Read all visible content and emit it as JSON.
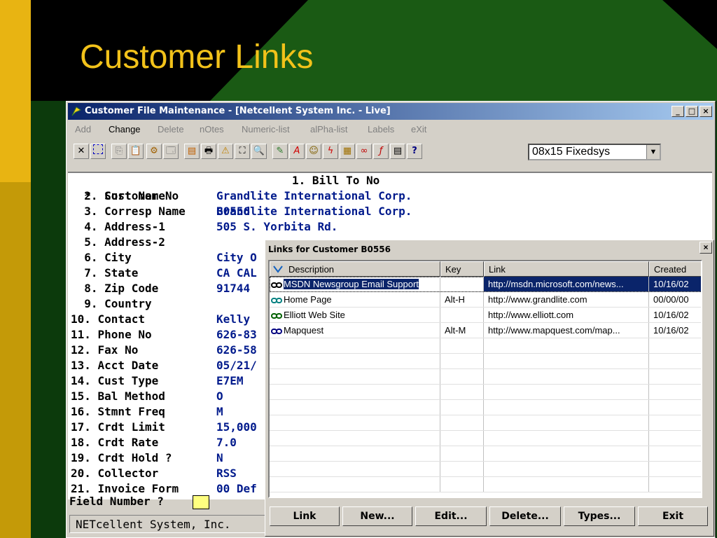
{
  "slide": {
    "title": "Customer Links"
  },
  "window": {
    "title": "Customer File Maintenance - [Netcellent System Inc. - Live]",
    "controls": {
      "minimize": "_",
      "maximize": "□",
      "close": "×"
    }
  },
  "menu": [
    {
      "label": "Add",
      "enabled": false
    },
    {
      "label": "Change",
      "enabled": true
    },
    {
      "label": "Delete",
      "enabled": false
    },
    {
      "label": "nOtes",
      "enabled": false
    },
    {
      "label": "Numeric-list",
      "enabled": false
    },
    {
      "label": "alPha-list",
      "enabled": false
    },
    {
      "label": "Labels",
      "enabled": false
    },
    {
      "label": "eXit",
      "enabled": false
    }
  ],
  "toolbar": {
    "icons": [
      "close-icon",
      "select-icon",
      "copy-icon",
      "paste-icon",
      "settings-icon",
      "properties-icon",
      "notes-icon",
      "print-icon",
      "alert-icon",
      "find-icon",
      "zoom-icon",
      "logo-icon",
      "font-icon",
      "user-icon",
      "lightning-icon",
      "calc-icon",
      "link-icon",
      "function-icon",
      "list-icon",
      "help-icon"
    ],
    "font_select": {
      "value": "08x15 Fixedsys"
    }
  },
  "fields": [
    {
      "label": "  *  Customer No",
      "value": "B0556"
    },
    {
      "label": "  2. Sort Name",
      "value": "Grandlite International Corp."
    },
    {
      "label": "  3. Corresp Name",
      "value": "Grandlite International Corp."
    },
    {
      "label": "  4. Address-1",
      "value": "505 S. Yorbita Rd."
    },
    {
      "label": "  5. Address-2",
      "value": ""
    },
    {
      "label": "  6. City",
      "value": "City O"
    },
    {
      "label": "  7. State",
      "value": "CA CAL"
    },
    {
      "label": "  8. Zip Code",
      "value": "91744"
    },
    {
      "label": "  9. Country",
      "value": ""
    },
    {
      "label": "10. Contact",
      "value": "Kelly"
    },
    {
      "label": "11. Phone No",
      "value": "626-83"
    },
    {
      "label": "12. Fax No",
      "value": "626-58"
    },
    {
      "label": "13. Acct Date",
      "value": "05/21/"
    },
    {
      "label": "14. Cust Type",
      "value": "E7EM"
    },
    {
      "label": "15. Bal Method",
      "value": "O"
    },
    {
      "label": "16. Stmnt Freq",
      "value": "M"
    },
    {
      "label": "17. Crdt Limit",
      "value": "15,000"
    },
    {
      "label": "18. Crdt Rate",
      "value": "7.0"
    },
    {
      "label": "19. Crdt Hold ?",
      "value": "N"
    },
    {
      "label": "20. Collector",
      "value": "RSS"
    },
    {
      "label": "21. Invoice Form",
      "value": "00 Def"
    }
  ],
  "bill_to": "1. Bill To No",
  "prompt": {
    "label": "Field Number ?"
  },
  "status": {
    "text": "NETcellent System, Inc."
  },
  "dialog": {
    "title": "Links for Customer B0556",
    "close": "×",
    "columns": [
      "Description",
      "Key",
      "Link",
      "Created"
    ],
    "rows": [
      {
        "description": "MSDN Newsgroup Email Support",
        "key": "",
        "link": "http://msdn.microsoft.com/news...",
        "created": "10/16/02",
        "selected": true
      },
      {
        "description": "Home Page",
        "key": "Alt-H",
        "link": "http://www.grandlite.com",
        "created": "00/00/00",
        "selected": false
      },
      {
        "description": "Elliott Web Site",
        "key": "",
        "link": "http://www.elliott.com",
        "created": "10/16/02",
        "selected": false
      },
      {
        "description": "Mapquest",
        "key": "Alt-M",
        "link": "http://www.mapquest.com/map...",
        "created": "10/16/02",
        "selected": false
      }
    ],
    "buttons": [
      "Link",
      "New...",
      "Edit...",
      "Delete...",
      "Types...",
      "Exit"
    ]
  },
  "colors": {
    "title": "#f2c21a",
    "field_value": "#001a8c",
    "selection": "#0a246a",
    "accent_bar": "#e5b00f"
  }
}
